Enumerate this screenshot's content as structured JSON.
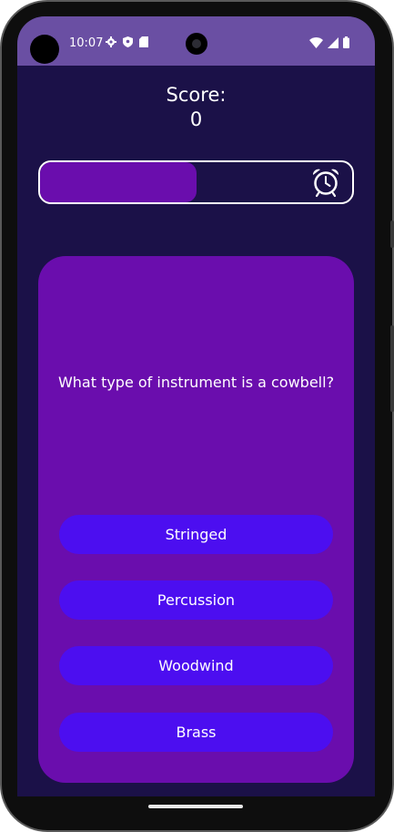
{
  "status_bar": {
    "time": "10:07",
    "left_icons": [
      "gear-icon",
      "shield-icon",
      "sd-card-icon"
    ],
    "right_icons": [
      "wifi-icon",
      "cell-signal-icon",
      "battery-icon"
    ],
    "background": "#6a4fa3"
  },
  "score": {
    "label": "Score:",
    "value": "0"
  },
  "timer": {
    "remaining_fraction": 0.5,
    "icon": "alarm-clock-icon",
    "fill_color": "#6a0dad"
  },
  "question": {
    "text": "What type of instrument is a cowbell?"
  },
  "answers": [
    {
      "label": "Stringed"
    },
    {
      "label": "Percussion"
    },
    {
      "label": "Woodwind"
    },
    {
      "label": "Brass"
    }
  ],
  "colors": {
    "background": "#1b1148",
    "card": "#6a0dad",
    "answer_button": "#4c0ef0",
    "text": "#ffffff"
  }
}
